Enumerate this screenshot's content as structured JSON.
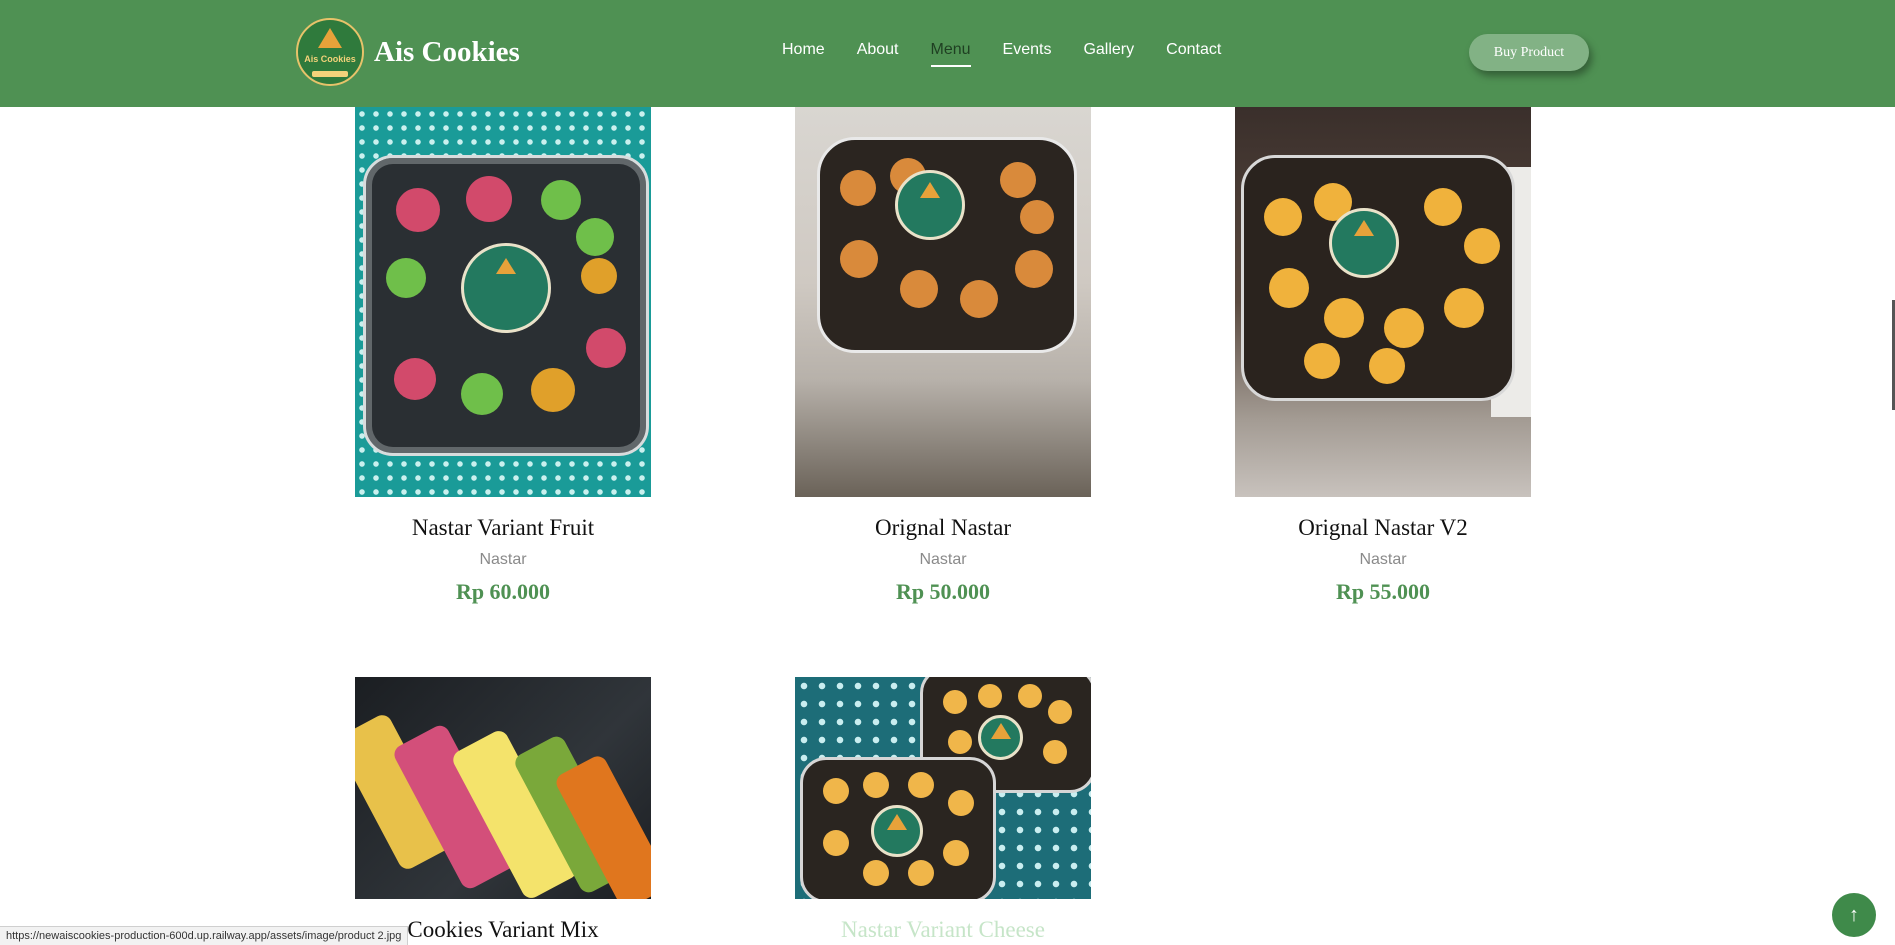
{
  "header": {
    "brand": "Ais Cookies",
    "logo_text": "Ais Cookies",
    "nav": [
      "Home",
      "About",
      "Menu",
      "Events",
      "Gallery",
      "Contact"
    ],
    "active_nav": "Menu",
    "cta": "Buy Product"
  },
  "products": [
    {
      "name": "Nastar Variant Fruit",
      "category": "Nastar",
      "price": "Rp 60.000"
    },
    {
      "name": "Orignal Nastar",
      "category": "Nastar",
      "price": "Rp 50.000"
    },
    {
      "name": "Orignal Nastar V2",
      "category": "Nastar",
      "price": "Rp 55.000"
    },
    {
      "name": "Cookies Variant Mix"
    },
    {
      "name": "Nastar Variant Cheese"
    }
  ],
  "status_bar_url": "https://newaiscookies-production-600d.up.railway.app/assets/image/product 2.jpg",
  "back_to_top_icon": "arrow-up-icon",
  "colors": {
    "brand_green": "#4f9153",
    "price_green": "#4f9153",
    "cta_bg": "#82b285"
  }
}
